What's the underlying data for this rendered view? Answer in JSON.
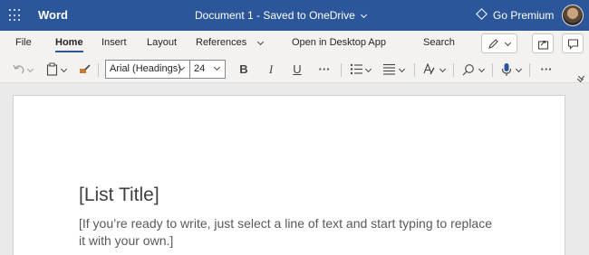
{
  "titlebar": {
    "app_name": "Word",
    "doc_title": "Document 1  -  Saved to OneDrive",
    "premium_label": "Go Premium"
  },
  "menu": {
    "tabs": [
      "File",
      "Home",
      "Insert",
      "Layout",
      "References"
    ],
    "active_tab": "Home",
    "open_desktop": "Open in Desktop App",
    "search": "Search"
  },
  "toolbar": {
    "font_name": "Arial (Headings)",
    "font_size": "24",
    "bold": "B",
    "italic": "I",
    "underline": "U",
    "more": "···"
  },
  "document": {
    "title": "[List Title]",
    "body": "[If you’re ready to write, just select a line of text and start typing to replace it with your own.]"
  },
  "colors": {
    "brand": "#2b579a",
    "ribbon_bg": "#f3f2f1",
    "canvas_bg": "#eaeaea"
  }
}
